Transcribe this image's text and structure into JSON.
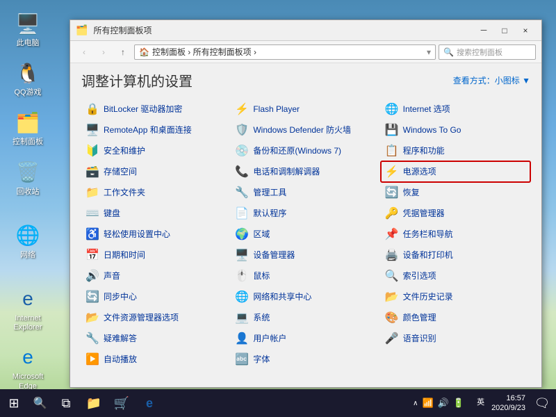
{
  "desktop": {
    "icons": [
      {
        "id": "computer",
        "label": "此电脑",
        "emoji": "🖥️"
      },
      {
        "id": "qq",
        "label": "QQ游戏",
        "emoji": "🐧"
      },
      {
        "id": "controlpanel",
        "label": "控制面板",
        "emoji": "🗂️"
      },
      {
        "id": "recycle",
        "label": "回收站",
        "emoji": "🗑️"
      },
      {
        "id": "network",
        "label": "网络",
        "emoji": "🌐"
      },
      {
        "id": "ie",
        "label": "Internet Explorer",
        "emoji": "🌐"
      },
      {
        "id": "edge",
        "label": "Microsoft Edge",
        "emoji": "🌀"
      }
    ]
  },
  "window": {
    "title": "所有控制面板项",
    "title_icon": "🗂️",
    "address": {
      "back_disabled": true,
      "forward_disabled": true,
      "path": "控制面板  ›  所有控制面板项  ›",
      "search_placeholder": "搜索控制面板"
    },
    "header_title": "调整计算机的设置",
    "view_label": "查看方式：小图标 ▼",
    "controls": {
      "minimize": "－",
      "maximize": "□",
      "close": "×"
    }
  },
  "cp_items": [
    {
      "id": "bitlocker",
      "label": "BitLocker 驱动器加密",
      "emoji": "🔒",
      "highlighted": false
    },
    {
      "id": "flash",
      "label": "Flash Player",
      "emoji": "⚡",
      "highlighted": false
    },
    {
      "id": "internet",
      "label": "Internet 选项",
      "emoji": "🌐",
      "highlighted": false
    },
    {
      "id": "remoteapp",
      "label": "RemoteApp 和桌面连接",
      "emoji": "🖥️",
      "highlighted": false
    },
    {
      "id": "defender",
      "label": "Windows Defender 防火墙",
      "emoji": "🛡️",
      "highlighted": false
    },
    {
      "id": "windowstogo",
      "label": "Windows To Go",
      "emoji": "💾",
      "highlighted": false
    },
    {
      "id": "security",
      "label": "安全和维护",
      "emoji": "🔰",
      "highlighted": false
    },
    {
      "id": "backup",
      "label": "备份和还原(Windows 7)",
      "emoji": "💿",
      "highlighted": false
    },
    {
      "id": "programs",
      "label": "程序和功能",
      "emoji": "📋",
      "highlighted": false
    },
    {
      "id": "storage",
      "label": "存储空间",
      "emoji": "🗃️",
      "highlighted": false
    },
    {
      "id": "phone",
      "label": "电话和调制解调器",
      "emoji": "📞",
      "highlighted": false
    },
    {
      "id": "power",
      "label": "电源选项",
      "emoji": "⚡",
      "highlighted": true
    },
    {
      "id": "workfolder",
      "label": "工作文件夹",
      "emoji": "📁",
      "highlighted": false
    },
    {
      "id": "tools",
      "label": "管理工具",
      "emoji": "🔧",
      "highlighted": false
    },
    {
      "id": "recover",
      "label": "恢复",
      "emoji": "🔄",
      "highlighted": false
    },
    {
      "id": "keyboard",
      "label": "键盘",
      "emoji": "⌨️",
      "highlighted": false
    },
    {
      "id": "defaults",
      "label": "默认程序",
      "emoji": "📄",
      "highlighted": false
    },
    {
      "id": "credentials",
      "label": "凭据管理器",
      "emoji": "🔑",
      "highlighted": false
    },
    {
      "id": "easycenter",
      "label": "轻松使用设置中心",
      "emoji": "♿",
      "highlighted": false
    },
    {
      "id": "region",
      "label": "区域",
      "emoji": "🌍",
      "highlighted": false
    },
    {
      "id": "taskbar",
      "label": "任务栏和导航",
      "emoji": "📌",
      "highlighted": false
    },
    {
      "id": "datetime",
      "label": "日期和时间",
      "emoji": "📅",
      "highlighted": false
    },
    {
      "id": "devmgr",
      "label": "设备管理器",
      "emoji": "🖥️",
      "highlighted": false
    },
    {
      "id": "devices",
      "label": "设备和打印机",
      "emoji": "🖨️",
      "highlighted": false
    },
    {
      "id": "sound",
      "label": "声音",
      "emoji": "🔊",
      "highlighted": false
    },
    {
      "id": "mouse",
      "label": "鼠标",
      "emoji": "🖱️",
      "highlighted": false
    },
    {
      "id": "indexoptions",
      "label": "索引选项",
      "emoji": "🔍",
      "highlighted": false
    },
    {
      "id": "synccenter",
      "label": "同步中心",
      "emoji": "🔄",
      "highlighted": false
    },
    {
      "id": "network2",
      "label": "网络和共享中心",
      "emoji": "🌐",
      "highlighted": false
    },
    {
      "id": "filehistory",
      "label": "文件历史记录",
      "emoji": "📂",
      "highlighted": false
    },
    {
      "id": "filemanager",
      "label": "文件资源管理器选项",
      "emoji": "📂",
      "highlighted": false
    },
    {
      "id": "system",
      "label": "系统",
      "emoji": "💻",
      "highlighted": false
    },
    {
      "id": "colormgmt",
      "label": "颜色管理",
      "emoji": "🎨",
      "highlighted": false
    },
    {
      "id": "troubleshoot",
      "label": "疑难解答",
      "emoji": "🔧",
      "highlighted": false
    },
    {
      "id": "useraccount",
      "label": "用户帐户",
      "emoji": "👤",
      "highlighted": false
    },
    {
      "id": "speech",
      "label": "语音识别",
      "emoji": "🎤",
      "highlighted": false
    },
    {
      "id": "autoplay",
      "label": "自动播放",
      "emoji": "▶️",
      "highlighted": false
    },
    {
      "id": "font",
      "label": "字体",
      "emoji": "🔤",
      "highlighted": false
    }
  ],
  "taskbar": {
    "start_icon": "⊞",
    "search_icon": "🔍",
    "time": "16:57",
    "date": "2020/9/23",
    "lang_top": "英",
    "lang_bottom": "英",
    "tray_icons": [
      "∧",
      "📶",
      "🔊",
      "⌚",
      "🖮"
    ]
  }
}
